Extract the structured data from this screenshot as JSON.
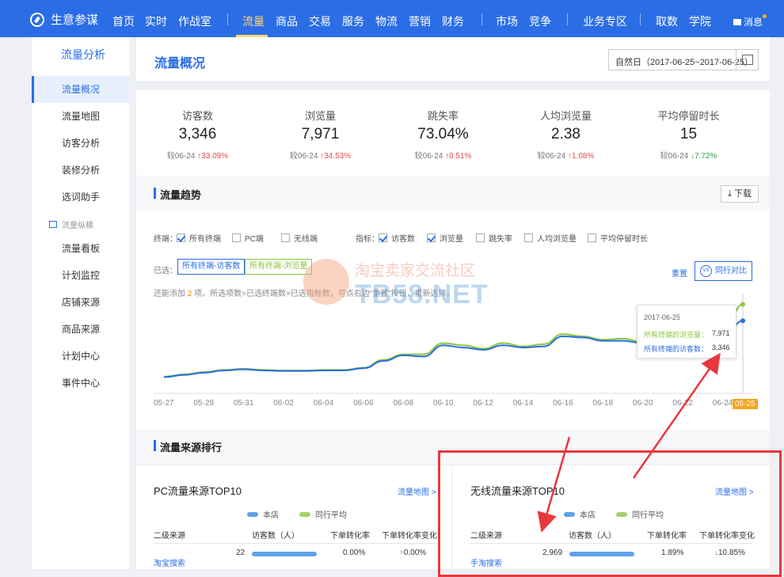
{
  "topbar": {
    "brand": "生意参谋",
    "nav": [
      "首页",
      "实时",
      "作战室",
      "流量",
      "商品",
      "交易",
      "服务",
      "物流",
      "营销",
      "财务",
      "市场",
      "竞争",
      "业务专区",
      "取数",
      "学院"
    ],
    "active": "流量",
    "message": "消息"
  },
  "sidebar": {
    "title": "流量分析",
    "items": [
      "流量概况",
      "流量地图",
      "访客分析",
      "装修分析",
      "选词助手"
    ],
    "group": "流量纵横",
    "group_items": [
      "流量看板",
      "计划监控",
      "店铺来源",
      "商品来源",
      "计划中心",
      "事件中心"
    ]
  },
  "header": {
    "title": "流量概况",
    "date_range": "自然日（2017-06-25~2017-06-25）"
  },
  "kpis": [
    {
      "label": "访客数",
      "value": "3,346",
      "compare": "较06-24",
      "change": "33.09%",
      "dir": "up"
    },
    {
      "label": "浏览量",
      "value": "7,971",
      "compare": "较06-24",
      "change": "34.53%",
      "dir": "up"
    },
    {
      "label": "跳失率",
      "value": "73.04%",
      "compare": "较06-24",
      "change": "0.51%",
      "dir": "up"
    },
    {
      "label": "人均浏览量",
      "value": "2.38",
      "compare": "较06-24",
      "change": "1.08%",
      "dir": "up"
    },
    {
      "label": "平均停留时长",
      "value": "15",
      "compare": "较06-24",
      "change": "7.72%",
      "dir": "down"
    }
  ],
  "trend": {
    "title": "流量趋势",
    "download": "下载",
    "terminal_label": "终端：",
    "terminals": [
      {
        "label": "所有终端",
        "checked": true
      },
      {
        "label": "PC端",
        "checked": false
      },
      {
        "label": "无线端",
        "checked": false
      }
    ],
    "metric_label": "指标：",
    "metrics": [
      {
        "label": "访客数",
        "checked": true
      },
      {
        "label": "浏览量",
        "checked": true
      },
      {
        "label": "跳失率",
        "checked": false
      },
      {
        "label": "人均浏览量",
        "checked": false
      },
      {
        "label": "平均停留时长",
        "checked": false
      }
    ],
    "selected_label": "已选：",
    "tags": [
      "所有终端-访客数",
      "所有终端-浏览量"
    ],
    "reset": "重置",
    "compare": "同行对比",
    "vs": "VS",
    "hint_prefix": "还能添加",
    "hint_num": "2",
    "hint_suffix": "项。所选项数=已选终端数×已选指标数，可点右边“重置”按钮，重新选择。",
    "tooltip": {
      "date": "2017-06-25",
      "row1_label": "所有终端的浏览量：",
      "row1_value": "7,971",
      "row2_label": "所有终端的访客数：",
      "row2_value": "3,346"
    },
    "x_labels": [
      "05-27",
      "05-29",
      "05-31",
      "06-02",
      "06-04",
      "06-06",
      "06-08",
      "06-10",
      "06-12",
      "06-14",
      "06-16",
      "06-18",
      "06-20",
      "06-22",
      "06-24",
      "06-25"
    ]
  },
  "chart_data": {
    "type": "line",
    "x": [
      "05-27",
      "05-28",
      "05-29",
      "05-30",
      "05-31",
      "06-01",
      "06-02",
      "06-03",
      "06-04",
      "06-05",
      "06-06",
      "06-07",
      "06-08",
      "06-09",
      "06-10",
      "06-11",
      "06-12",
      "06-13",
      "06-14",
      "06-15",
      "06-16",
      "06-17",
      "06-18",
      "06-19",
      "06-20",
      "06-21",
      "06-22",
      "06-23",
      "06-24",
      "06-25"
    ],
    "series": [
      {
        "name": "所有终端的浏览量",
        "color": "#8cc63f",
        "values": [
          1500,
          1700,
          1900,
          2100,
          2200,
          2100,
          2050,
          2050,
          2100,
          2100,
          2300,
          3000,
          3500,
          3500,
          4500,
          4300,
          4000,
          4500,
          4200,
          4400,
          5300,
          5100,
          4800,
          4900,
          4600,
          4500,
          4600,
          4700,
          4900,
          7971
        ]
      },
      {
        "name": "所有终端的访客数",
        "color": "#2b6de5",
        "values": [
          1450,
          1650,
          1850,
          2050,
          2150,
          2050,
          2000,
          2000,
          2050,
          2050,
          2250,
          2900,
          3400,
          3300,
          4300,
          4100,
          3900,
          4300,
          4100,
          4200,
          5100,
          5000,
          4700,
          4700,
          4500,
          4400,
          4500,
          4600,
          4700,
          6500
        ]
      }
    ],
    "ylim": [
      0,
      8500
    ],
    "grid": false
  },
  "sources": {
    "title": "流量来源排行",
    "pc": {
      "title": "PC流量来源TOP10",
      "link": "流量地图 >",
      "legend": [
        "本店",
        "同行平均"
      ],
      "headers": [
        "二级来源",
        "访客数（人）",
        "下单转化率",
        "下单转化率变化"
      ],
      "rows": [
        {
          "name": "淘宝搜索",
          "visitors": "22",
          "rate": "0.00%",
          "change": "0.00%",
          "dir": "flat",
          "bar": 1.0,
          "peer": 0.0
        }
      ]
    },
    "mobile": {
      "title": "无线流量来源TOP10",
      "link": "流量地图 >",
      "legend": [
        "本店",
        "同行平均"
      ],
      "headers": [
        "二级来源",
        "访客数（人）",
        "下单转化率",
        "下单转化率变化"
      ],
      "rows": [
        {
          "name": "手淘搜索",
          "visitors": "2,969",
          "rate": "1.89%",
          "change": "10.85%",
          "dir": "down",
          "bar": 1.0,
          "peer": 0.0
        }
      ]
    }
  },
  "watermark": {
    "cn": "淘宝卖家交流社区",
    "en": "TB58.NET"
  },
  "colors": {
    "primary": "#2b6de5",
    "green": "#8cc63f",
    "red": "#e34a4a",
    "annotation": "#e8383d"
  }
}
